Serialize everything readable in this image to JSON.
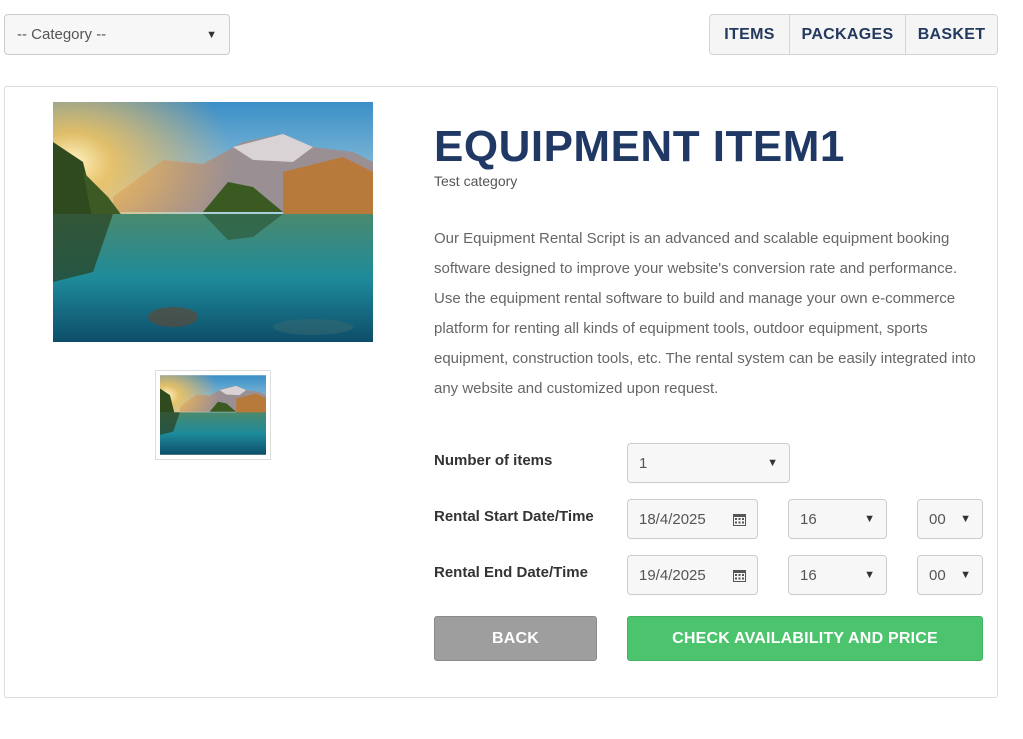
{
  "category_select": {
    "value": "-- Category --"
  },
  "nav": {
    "items": "ITEMS",
    "packages": "PACKAGES",
    "basket": "BASKET"
  },
  "product": {
    "title": "EQUIPMENT ITEM1",
    "category": "Test category",
    "description": "Our Equipment Rental Script is an advanced and scalable equipment booking software designed to improve your website's conversion rate and performance. Use the equipment rental software to build and manage your own e-commerce platform for renting all kinds of equipment tools, outdoor equipment, sports equipment, construction tools, etc. The rental system can be easily integrated into any website and customized upon request."
  },
  "form": {
    "quantity_label": "Number of items",
    "quantity_value": "1",
    "start_label": "Rental Start Date/Time",
    "start_date": "18/4/2025",
    "start_hour": "16",
    "start_minute": "00",
    "end_label": "Rental End Date/Time",
    "end_date": "19/4/2025",
    "end_hour": "16",
    "end_minute": "00"
  },
  "buttons": {
    "back": "BACK",
    "check": "CHECK AVAILABILITY AND PRICE"
  },
  "icons": {
    "dropdown": "chevron-down-icon",
    "calendar": "calendar-icon"
  },
  "colors": {
    "title": "#1f3864",
    "nav_text": "#23395d",
    "check_button": "#4cc46e",
    "back_button": "#9e9e9e"
  }
}
